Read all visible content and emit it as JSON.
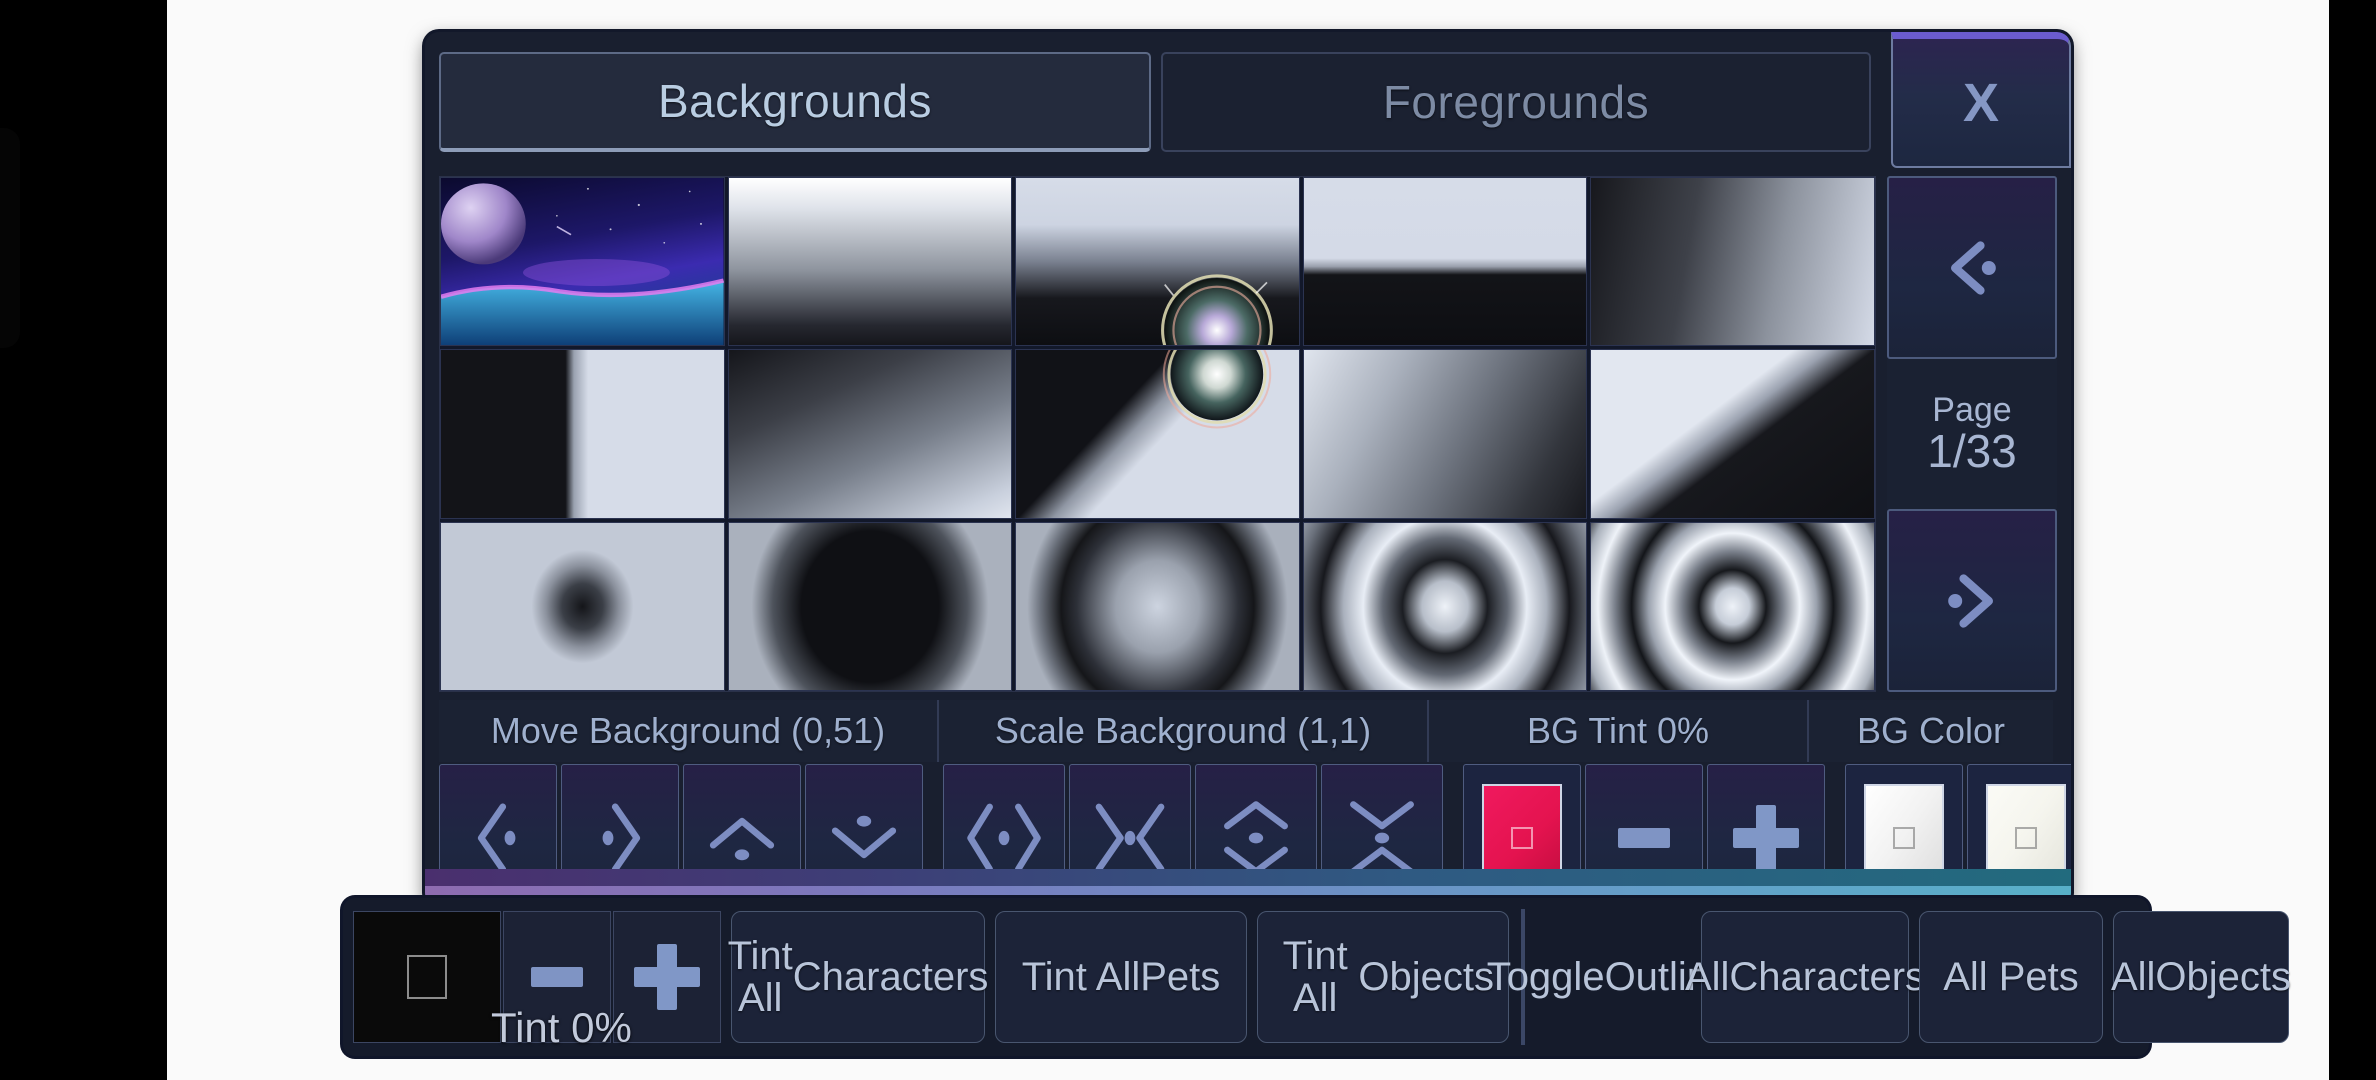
{
  "window": {
    "tabs": [
      {
        "id": "backgrounds",
        "label": "Backgrounds",
        "active": true
      },
      {
        "id": "foregrounds",
        "label": "Foregrounds",
        "active": false
      }
    ],
    "close_label": "X"
  },
  "pager": {
    "prev_icon": "chevron-left-dot-icon",
    "next_icon": "chevron-right-dot-icon",
    "page_label": "Page",
    "page_value": "1/33",
    "current_page": 1,
    "total_pages": 33
  },
  "thumbnails": [
    {
      "index": 1,
      "name": "space-planet-nebula"
    },
    {
      "index": 2,
      "name": "gradient-white-to-black-vertical"
    },
    {
      "index": 3,
      "name": "gradient-with-glow-orb"
    },
    {
      "index": 4,
      "name": "hard-split-white-black-horizontal"
    },
    {
      "index": 5,
      "name": "gradient-black-to-white-horizontal"
    },
    {
      "index": 6,
      "name": "split-black-white-vertical"
    },
    {
      "index": 7,
      "name": "gradient-diagonal-dark-light"
    },
    {
      "index": 8,
      "name": "diagonal-split-with-orb"
    },
    {
      "index": 9,
      "name": "gradient-diagonal-light-dark"
    },
    {
      "index": 10,
      "name": "diagonal-split-light-dark"
    },
    {
      "index": 11,
      "name": "radial-dark-center-soft"
    },
    {
      "index": 12,
      "name": "radial-dark-ellipse"
    },
    {
      "index": 13,
      "name": "radial-ring-single"
    },
    {
      "index": 14,
      "name": "radial-rings-double"
    },
    {
      "index": 15,
      "name": "radial-rings-triple"
    }
  ],
  "controls": {
    "groups": [
      {
        "id": "move-background",
        "label": "Move Background (0,51)",
        "buttons": [
          {
            "id": "move-left",
            "icon": "arrow-left-dot-icon"
          },
          {
            "id": "move-right",
            "icon": "arrow-right-dot-icon"
          },
          {
            "id": "move-up",
            "icon": "arrow-up-dot-icon"
          },
          {
            "id": "move-down",
            "icon": "arrow-down-dot-icon"
          }
        ]
      },
      {
        "id": "scale-background",
        "label": "Scale Background (1,1)",
        "buttons": [
          {
            "id": "scale-expand-horizontal",
            "icon": "expand-horizontal-icon"
          },
          {
            "id": "scale-shrink-horizontal",
            "icon": "shrink-horizontal-icon"
          },
          {
            "id": "scale-expand-vertical",
            "icon": "expand-vertical-icon"
          },
          {
            "id": "scale-shrink-vertical",
            "icon": "shrink-vertical-icon"
          }
        ]
      },
      {
        "id": "bg-tint",
        "label": "BG Tint 0%",
        "buttons": [
          {
            "id": "bg-tint-swatch",
            "icon": "color-swatch-icon",
            "color": "#E4134F"
          },
          {
            "id": "bg-tint-decrease",
            "icon": "minus-icon"
          },
          {
            "id": "bg-tint-increase",
            "icon": "plus-icon"
          }
        ]
      },
      {
        "id": "bg-color",
        "label": "BG Color",
        "buttons": [
          {
            "id": "bg-color-swatch-1",
            "icon": "color-swatch-icon",
            "color": "#FFFFFF"
          },
          {
            "id": "bg-color-swatch-2",
            "icon": "color-swatch-icon",
            "color": "#F5F5EE"
          }
        ]
      }
    ]
  },
  "bottom_bar": {
    "tint_swatch": {
      "name": "tint-color-swatch",
      "color": "#0A0A0A"
    },
    "tint_decrease": "minus-icon",
    "tint_increase": "plus-icon",
    "tint_readout": "Tint 0%",
    "buttons": [
      {
        "id": "tint-all-characters",
        "label": "Tint All\nCharacters"
      },
      {
        "id": "tint-all-pets",
        "label": "Tint All\nPets"
      },
      {
        "id": "tint-all-objects",
        "label": "Tint All\nObjects"
      }
    ],
    "outline_label": "Toggle\nOutlines",
    "outline_buttons": [
      {
        "id": "outline-all-characters",
        "label": "All\nCharacters"
      },
      {
        "id": "outline-all-pets",
        "label": "All Pets"
      },
      {
        "id": "outline-all-objects",
        "label": "All\nObjects"
      }
    ]
  },
  "theme": {
    "panel_bg": "#191f2f",
    "accent_blue": "#8fa3cd",
    "text_light": "#b8c4d9",
    "tint_red": "#E4134F",
    "strip_purple": "#8e6cb0",
    "strip_teal": "#58b0c9"
  }
}
